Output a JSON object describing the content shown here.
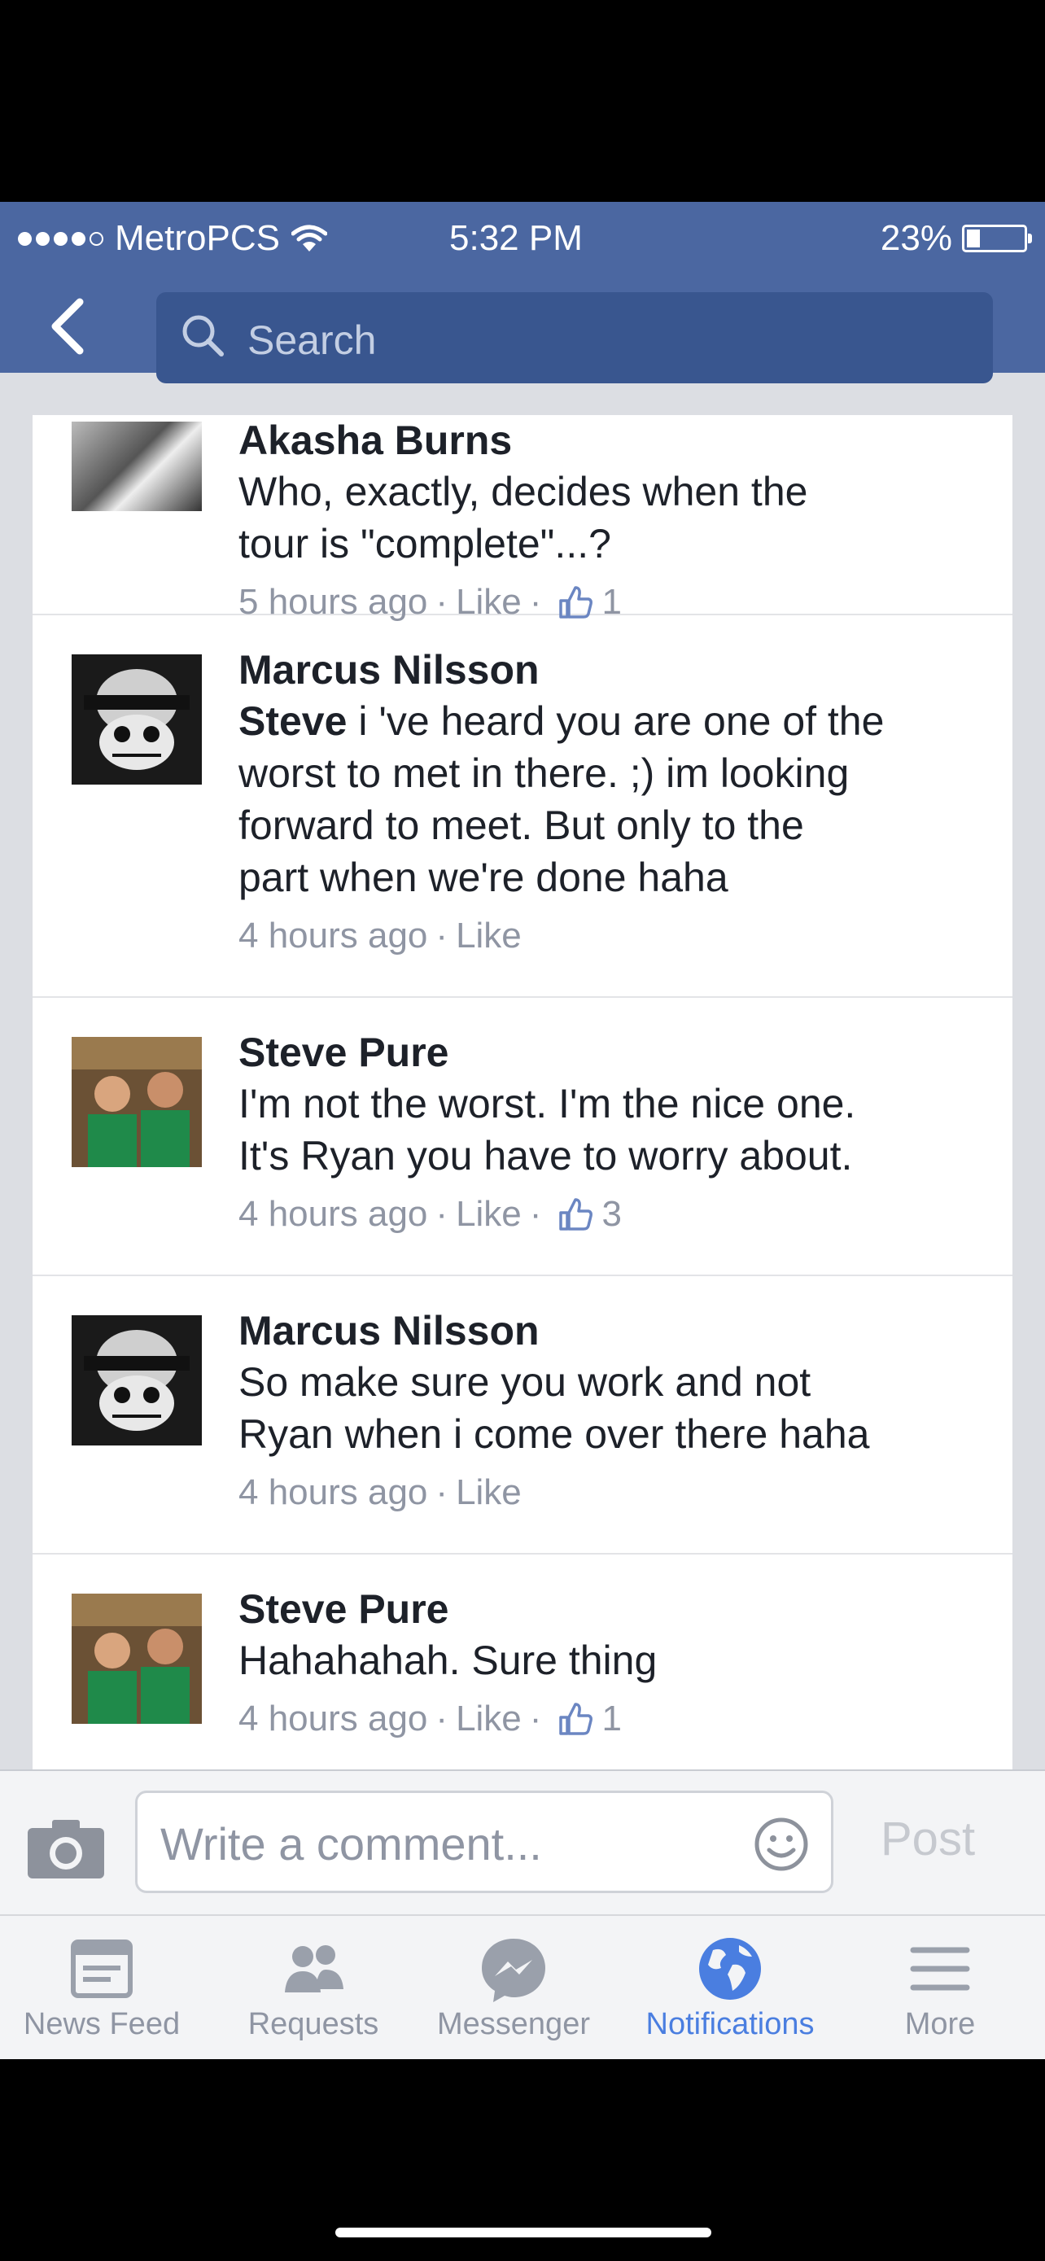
{
  "status_bar": {
    "carrier": "MetroPCS",
    "time": "5:32 PM",
    "battery": "23%",
    "signal_filled": 4,
    "signal_total": 5,
    "battery_level": 0.23
  },
  "nav": {
    "back_icon": "chevron-left-icon",
    "search_icon": "search-icon",
    "search_placeholder": "Search"
  },
  "comments": [
    {
      "name": "Akasha Burns",
      "text_lines": [
        "Who, exactly, decides when the",
        "tour is \"complete\"...?"
      ],
      "time": "5 hours ago",
      "like_label": "Like",
      "like_count": "1"
    },
    {
      "name": "Marcus Nilsson",
      "mention": "Steve",
      "text_lines": [
        " i 've heard you are one of the",
        "worst to met in there. ;) im looking",
        "forward to meet. But only to the",
        "part when we're done haha"
      ],
      "time": "4 hours ago",
      "like_label": "Like"
    },
    {
      "name": "Steve Pure",
      "text_lines": [
        "I'm not the worst. I'm the nice one.",
        "It's Ryan you have to worry about."
      ],
      "time": "4 hours ago",
      "like_label": "Like",
      "like_count": "3"
    },
    {
      "name": "Marcus Nilsson",
      "text_lines": [
        "So make sure you work and not",
        "Ryan when i come over there haha"
      ],
      "time": "4 hours ago",
      "like_label": "Like"
    },
    {
      "name": "Steve Pure",
      "text_lines": [
        "Hahahahah.  Sure thing"
      ],
      "time": "4 hours ago",
      "like_label": "Like",
      "like_count": "1"
    }
  ],
  "composer": {
    "camera_icon": "camera-icon",
    "placeholder": "Write a comment...",
    "emoji_icon": "smiley-icon",
    "post_label": "Post"
  },
  "tabs": [
    {
      "label": "News Feed",
      "icon": "news-feed-icon",
      "active": false
    },
    {
      "label": "Requests",
      "icon": "friend-requests-icon",
      "active": false
    },
    {
      "label": "Messenger",
      "icon": "messenger-icon",
      "active": false
    },
    {
      "label": "Notifications",
      "icon": "globe-icon",
      "active": true
    },
    {
      "label": "More",
      "icon": "menu-icon",
      "active": false
    }
  ],
  "colors": {
    "brand_blue": "#4b67a1",
    "active_tab": "#4a7ee0",
    "meta_gray": "#8f95a3"
  }
}
